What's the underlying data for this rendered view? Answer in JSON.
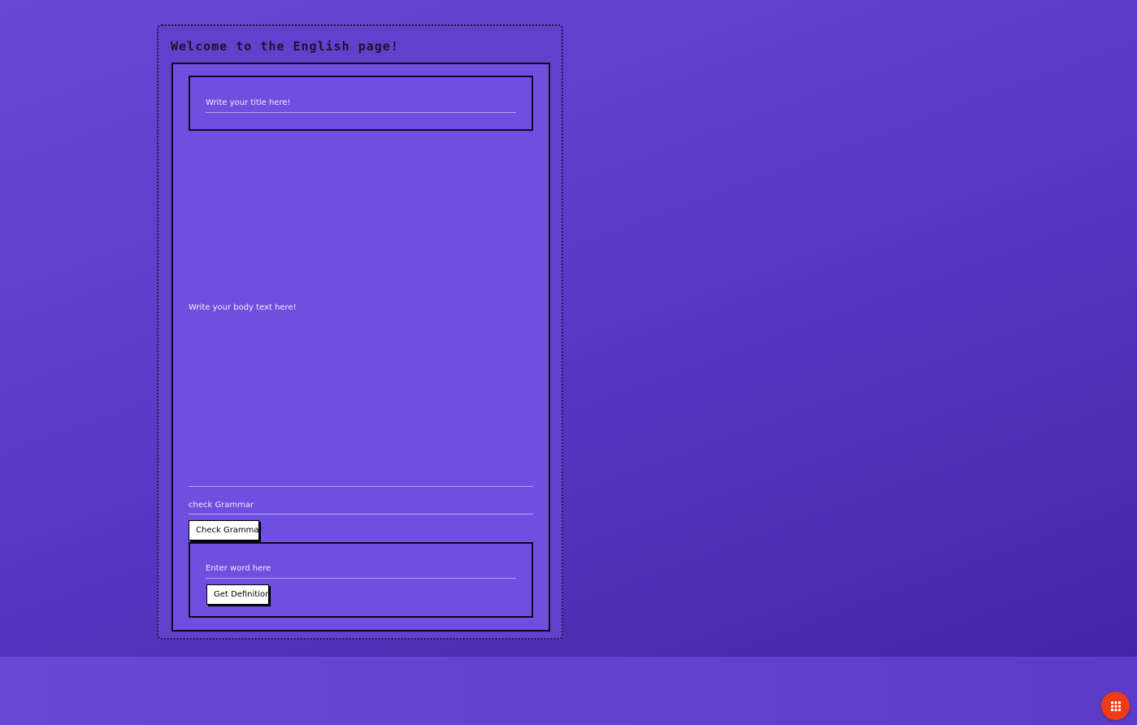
{
  "page": {
    "title": "Welcome to the English page!"
  },
  "title_field": {
    "placeholder": "Write your title here!"
  },
  "body_field": {
    "placeholder": "Write your body text here!"
  },
  "grammar": {
    "field_placeholder": "check Grammar",
    "button_label": "Check Grammar"
  },
  "definition": {
    "field_placeholder": "Enter word here",
    "button_label": "Get Definition"
  },
  "fab": {
    "icon": "grid-icon",
    "color": "#f03c14"
  },
  "colors": {
    "background": "#5a3ac7",
    "panel": "#6f4fdf",
    "border": "#0d0820"
  }
}
